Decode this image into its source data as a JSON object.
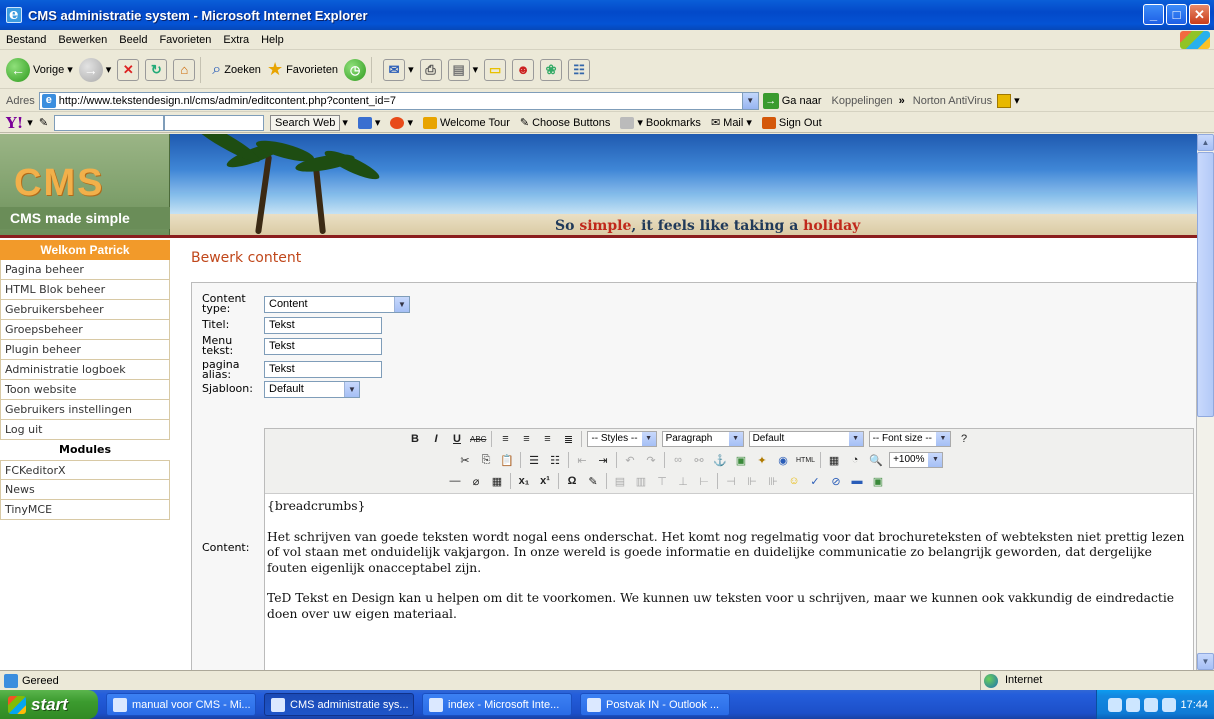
{
  "window": {
    "title": "CMS administratie system - Microsoft Internet Explorer"
  },
  "menu": [
    "Bestand",
    "Bewerken",
    "Beeld",
    "Favorieten",
    "Extra",
    "Help"
  ],
  "toolbar": {
    "back": "Vorige",
    "search": "Zoeken",
    "favorites": "Favorieten"
  },
  "address": {
    "label": "Adres",
    "url": "http://www.tekstendesign.nl/cms/admin/editcontent.php?content_id=7",
    "go": "Ga naar",
    "links": "Koppelingen",
    "norton": "Norton AntiVirus"
  },
  "yahoo": {
    "search_web": "Search Web",
    "welcome": "Welcome Tour",
    "choose": "Choose Buttons",
    "bookmarks": "Bookmarks",
    "mail": "Mail",
    "signout": "Sign Out"
  },
  "banner": {
    "logo": "CMS",
    "logo_sub": "CMS made simple",
    "slogan_a": "So ",
    "slogan_b": "simple",
    "slogan_c": ", it feels like taking a ",
    "slogan_d": "holiday"
  },
  "sidebar": {
    "welcome": "Welkom Patrick",
    "items": [
      "Pagina beheer",
      "HTML Blok beheer",
      "Gebruikersbeheer",
      "Groepsbeheer",
      "Plugin beheer",
      "Administratie logboek",
      "Toon website",
      "Gebruikers instellingen",
      "Log uit"
    ],
    "modules_title": "Modules",
    "modules": [
      "FCKeditorX",
      "News",
      "TinyMCE"
    ]
  },
  "page": {
    "title": "Bewerk content"
  },
  "form": {
    "content_type_label1": "Content",
    "content_type_label2": "type:",
    "content_type_value": "Content",
    "title_label": "Titel:",
    "title_value": "Tekst",
    "menu_label1": "Menu",
    "menu_label2": "tekst:",
    "menu_value": "Tekst",
    "alias_label1": "pagina",
    "alias_label2": "alias:",
    "alias_value": "Tekst",
    "template_label": "Sjabloon:",
    "template_value": "Default",
    "content_label": "Content:"
  },
  "editor": {
    "styles": "-- Styles --",
    "format": "Paragraph",
    "font": "Default",
    "fontsize": "-- Font size --",
    "zoom": "+100%",
    "body": {
      "p1": "{breadcrumbs}",
      "p2": "Het schrijven van goede teksten wordt nogal eens onderschat. Het komt nog regelmatig voor dat brochureteksten of webteksten niet prettig lezen of vol staan met onduidelijk vakjargon. In onze wereld is goede informatie en duidelijke communicatie zo belangrijk geworden, dat dergelijke fouten eigenlijk onacceptabel zijn.",
      "p3": "TeD Tekst en Design kan u helpen om dit te voorkomen. We kunnen uw teksten voor u schrijven, maar we kunnen ook vakkundig de eindredactie doen over uw eigen materiaal."
    }
  },
  "status": {
    "text": "Gereed",
    "zone": "Internet"
  },
  "taskbar": {
    "start": "start",
    "tasks": [
      "manual voor CMS - Mi...",
      "CMS administratie sys...",
      "index - Microsoft Inte...",
      "Postvak IN - Outlook ..."
    ],
    "clock": "17:44"
  }
}
